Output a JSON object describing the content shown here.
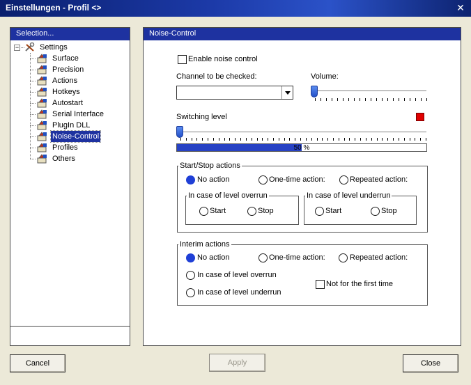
{
  "window": {
    "title": "Einstellungen - Profil <>"
  },
  "sidebar": {
    "header": "Selection...",
    "root_label": "Settings",
    "items": [
      {
        "label": "Surface"
      },
      {
        "label": "Precision"
      },
      {
        "label": "Actions"
      },
      {
        "label": "Hotkeys"
      },
      {
        "label": "Autostart"
      },
      {
        "label": "Serial Interface"
      },
      {
        "label": "PlugIn DLL"
      },
      {
        "label": "Noise-Control",
        "selected": true
      },
      {
        "label": "Profiles"
      },
      {
        "label": "Others"
      }
    ]
  },
  "main": {
    "header": "Noise-Control",
    "enable_label": "Enable noise control",
    "channel_label": "Channel to be checked:",
    "channel_value": "",
    "volume_label": "Volume:",
    "volume_level": 0,
    "switching_label": "Switching level",
    "switching_level": 0,
    "indicator_color": "#e00000",
    "progress": {
      "value": 50,
      "text": "50 %"
    },
    "start_stop": {
      "title": "Start/Stop actions",
      "no_action": "No action",
      "one_time": "One-time action:",
      "repeated": "Repeated action:",
      "overrun": {
        "title": "In case of level overrun",
        "start": "Start",
        "stop": "Stop"
      },
      "underrun": {
        "title": "In case of level underrun",
        "start": "Start",
        "stop": "Stop"
      }
    },
    "interim": {
      "title": "Interim actions",
      "no_action": "No action",
      "one_time": "One-time action:",
      "repeated": "Repeated action:",
      "overrun": "In case of level overrun",
      "underrun": "In case of level underrun",
      "not_first": "Not for the first time"
    }
  },
  "footer": {
    "cancel": "Cancel",
    "apply": "Apply",
    "close": "Close"
  },
  "colors": {
    "accent": "#1e32a0",
    "radio_on": "#1f3fd6"
  }
}
